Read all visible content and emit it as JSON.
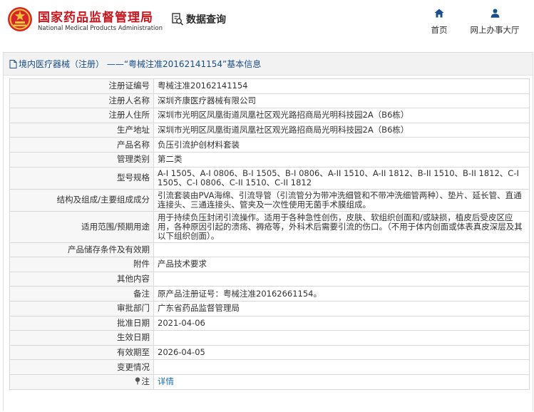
{
  "header": {
    "org_name_cn": "国家药品监督管理局",
    "org_name_en": "National Medical Products Administration",
    "query_label": "数据查询",
    "nav": {
      "home": "首页",
      "service": "网上办事大厅"
    }
  },
  "breadcrumb": "境内医疗器械（注册） ——“粤械注准20162141154”基本信息",
  "rows": [
    {
      "key": "注册证编号",
      "value": "粤械注准20162141154"
    },
    {
      "key": "注册人名称",
      "value": "深圳齐康医疗器械有限公司"
    },
    {
      "key": "注册人住所",
      "value": "深圳市光明区凤凰街道凤凰社区观光路招商局光明科技园2A（B6栋）"
    },
    {
      "key": "生产地址",
      "value": "深圳市光明区凤凰街道凤凰社区观光路招商局光明科技园2A（B6栋）"
    },
    {
      "key": "产品名称",
      "value": "负压引流护创材料套装"
    },
    {
      "key": "管理类别",
      "value": "第二类"
    },
    {
      "key": "型号规格",
      "value": "A-I 1505、A-I 0806、B-I 1505、B-I 0806、A-II 1510、A-II 1812、B-II 1510、B-II 1812、C-I 1505、C-I 0806、C-II 1510、C-II 1812"
    },
    {
      "key": "结构及组成/主要组成成分",
      "value": "引流套装由PVA海绵、引流导管（引流管分为带冲洗细管和不带冲洗细管两种）、垫片、延长管、直通连接头、三通连接头、管夹及一次性使用无菌手术膜组成。"
    },
    {
      "key": "适用范围/预期用途",
      "value": "用于持续负压封闭引流操作。适用于各种急性创伤，皮肤、软组织创面和/或缺损，植皮后受皮区应用，各种原因引起的溃疡、褥疮等，外科术后需要引流的伤口。（不用于体内创面或体表真皮深层及其以下组织创面）。"
    },
    {
      "key": "产品储存条件及有效期",
      "value": ""
    },
    {
      "key": "附件",
      "value": "产品技术要求"
    },
    {
      "key": "其他内容",
      "value": ""
    },
    {
      "key": "备注",
      "value": "原产品注册证号：粤械注准20162661154。"
    },
    {
      "key": "审批部门",
      "value": "广东省药品监督管理局"
    },
    {
      "key": "批准日期",
      "value": "2021-04-06"
    },
    {
      "key": "生效日期",
      "value": ""
    },
    {
      "key": "有效期至",
      "value": "2026-04-05"
    },
    {
      "key": "变更情况",
      "value": ""
    }
  ],
  "note_row": {
    "key": "注",
    "link": "详情"
  },
  "colors": {
    "brand_red": "#c7161e",
    "nav_blue": "#1a4e8a",
    "link_blue": "#1a6bb8"
  }
}
